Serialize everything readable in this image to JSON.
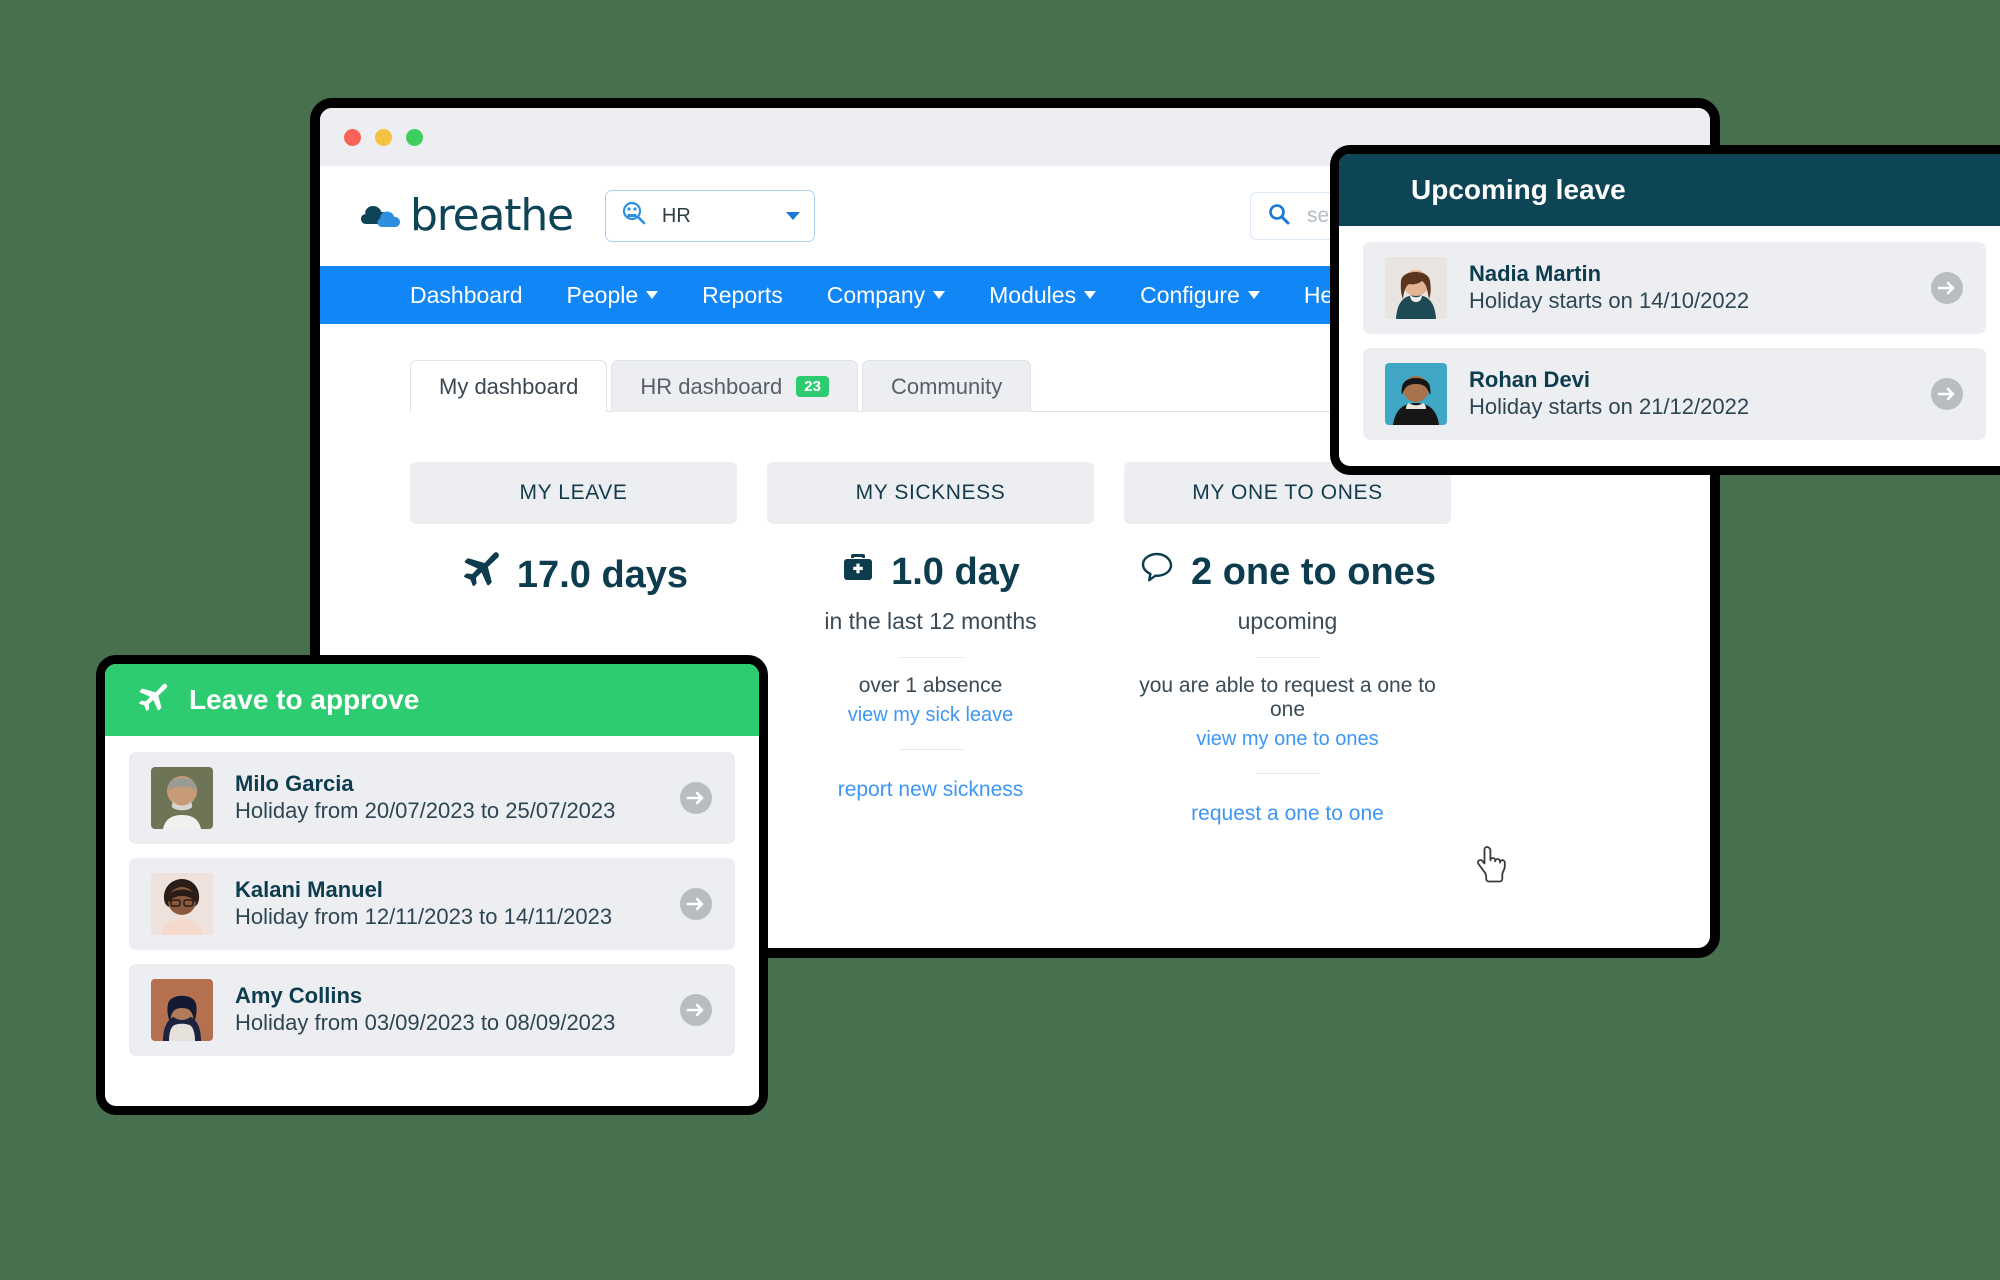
{
  "background_color": "#47704f",
  "browser": {
    "traffic_lights": [
      "close",
      "minimize",
      "zoom"
    ]
  },
  "app_header": {
    "logo_text": "breathe",
    "logo_icon": "cloud-icon",
    "module_select": {
      "icon": "people-search-icon",
      "value": "HR",
      "caret": "chevron-down-icon"
    },
    "search": {
      "icon": "search-icon",
      "placeholder": "search people"
    }
  },
  "main_nav": {
    "items": [
      {
        "label": "Dashboard",
        "has_caret": false
      },
      {
        "label": "People",
        "has_caret": true
      },
      {
        "label": "Reports",
        "has_caret": false
      },
      {
        "label": "Company",
        "has_caret": true
      },
      {
        "label": "Modules",
        "has_caret": true
      },
      {
        "label": "Configure",
        "has_caret": true
      },
      {
        "label": "He",
        "has_caret": false
      }
    ]
  },
  "tabs": [
    {
      "label": "My dashboard",
      "active": true,
      "badge": null
    },
    {
      "label": "HR dashboard",
      "active": false,
      "badge": "23"
    },
    {
      "label": "Community",
      "active": false,
      "badge": null
    }
  ],
  "stats": [
    {
      "heading": "MY LEAVE",
      "icon": "plane-icon",
      "value": "17.0 days",
      "subtitle": "",
      "note": "",
      "link": "",
      "action": ""
    },
    {
      "heading": "MY SICKNESS",
      "icon": "first-aid-kit-icon",
      "value": "1.0 day",
      "subtitle": "in the last 12 months",
      "note": "over 1 absence",
      "link": "view my sick leave",
      "action": "report new sickness"
    },
    {
      "heading": "MY ONE TO ONES",
      "icon": "speech-bubble-icon",
      "value": "2 one to ones",
      "subtitle": "upcoming",
      "note": "you are able to request a one to one",
      "link": "view my one to ones",
      "action": "request a one to one"
    }
  ],
  "leave_to_approve": {
    "title": "Leave to approve",
    "icon": "plane-icon",
    "rows": [
      {
        "name": "Milo Garcia",
        "detail": "Holiday from 20/07/2023 to 25/07/2023",
        "arrow": "arrow-right-icon"
      },
      {
        "name": "Kalani Manuel",
        "detail": "Holiday from 12/11/2023 to 14/11/2023",
        "arrow": "arrow-right-icon"
      },
      {
        "name": "Amy Collins",
        "detail": "Holiday from 03/09/2023 to 08/09/2023",
        "arrow": "arrow-right-icon"
      }
    ]
  },
  "upcoming_leave": {
    "title": "Upcoming leave",
    "rows": [
      {
        "name": "Nadia Martin",
        "detail": "Holiday starts on 14/10/2022",
        "arrow": "arrow-right-icon"
      },
      {
        "name": "Rohan Devi",
        "detail": "Holiday starts on 21/12/2022",
        "arrow": "arrow-right-icon"
      }
    ]
  },
  "cursor": {
    "icon": "pointing-hand-cursor"
  },
  "colors": {
    "nav_blue": "#1186f7",
    "link_blue": "#3e96f4",
    "brand_navy": "#0d4456",
    "accent_green": "#2ecc71",
    "panel_grey": "#eceef1"
  }
}
